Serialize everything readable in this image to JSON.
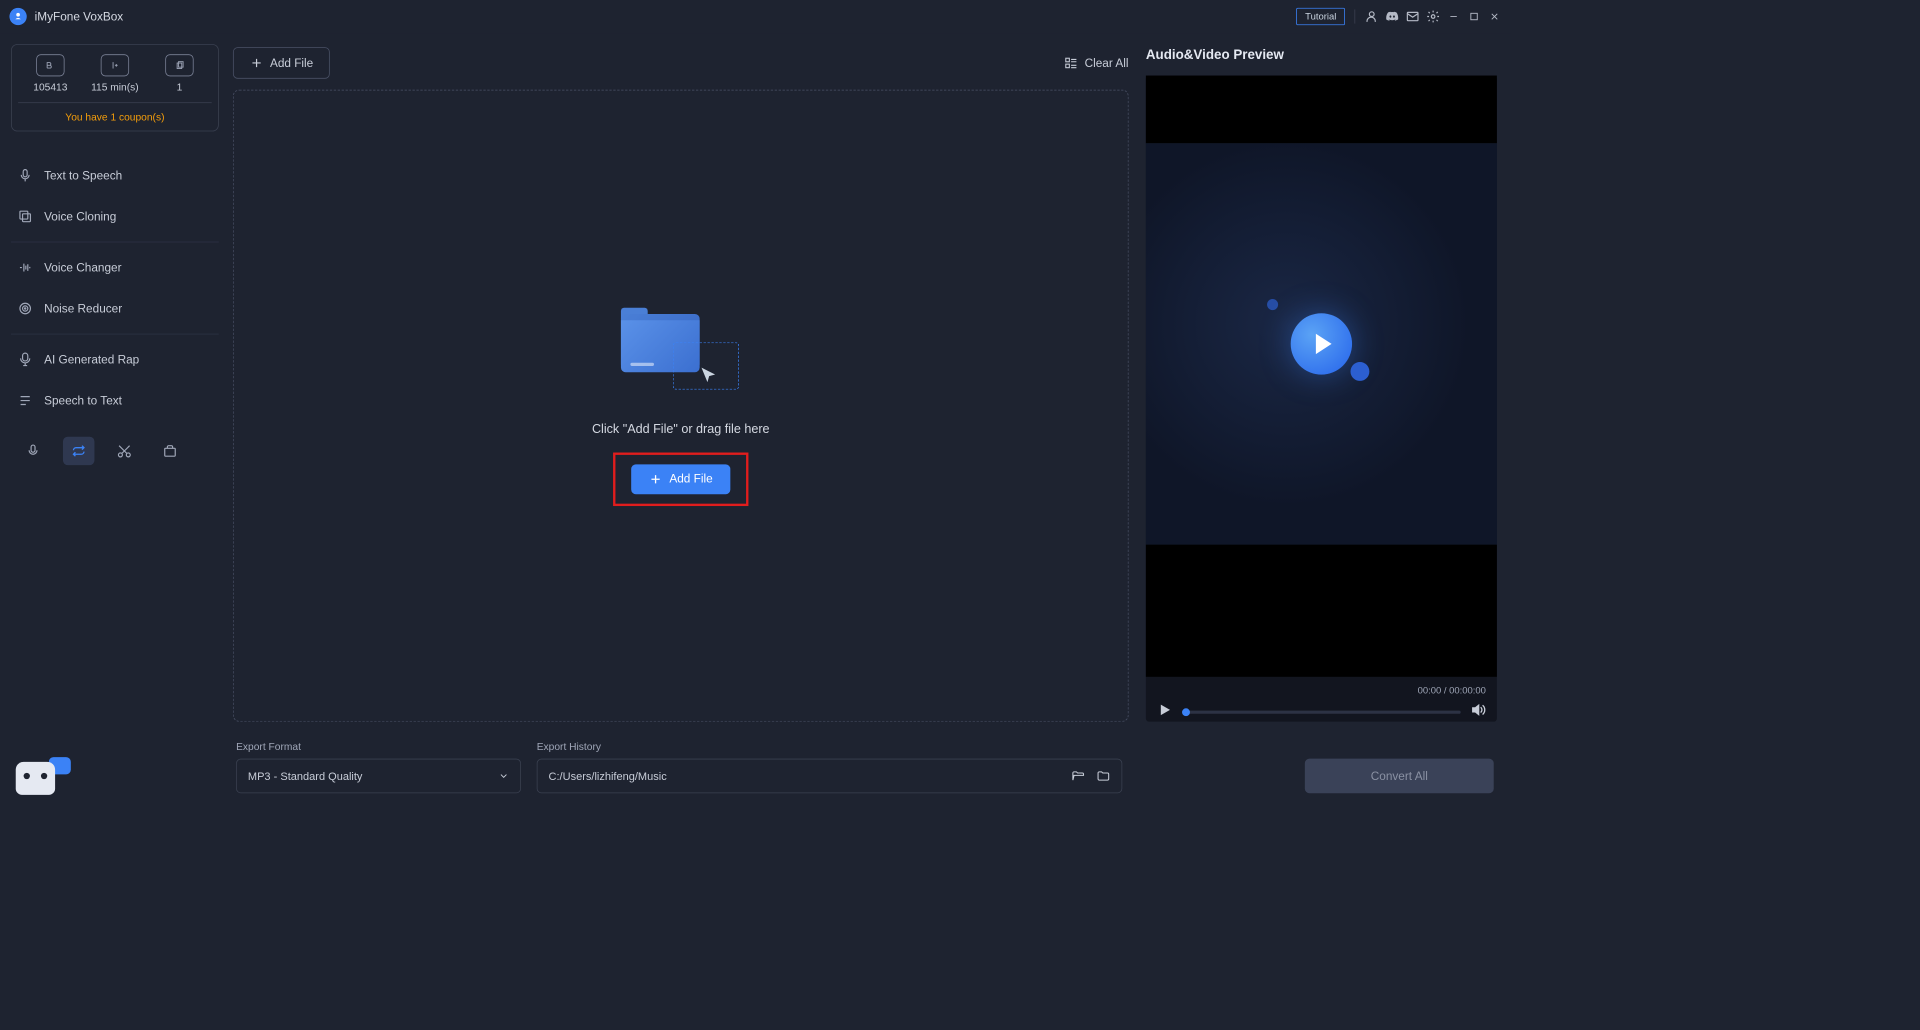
{
  "titlebar": {
    "app_name": "iMyFone VoxBox",
    "tutorial_label": "Tutorial"
  },
  "sidebar": {
    "stats": {
      "characters": "105413",
      "minutes": "115 min(s)",
      "count": "1"
    },
    "coupon_text": "You have 1 coupon(s)",
    "nav": [
      {
        "label": "Text to Speech",
        "icon": "mic-text-icon"
      },
      {
        "label": "Voice Cloning",
        "icon": "clone-icon"
      },
      {
        "label": "Voice Changer",
        "icon": "voice-change-icon"
      },
      {
        "label": "Noise Reducer",
        "icon": "noise-icon"
      },
      {
        "label": "AI Generated Rap",
        "icon": "rap-icon"
      },
      {
        "label": "Speech to Text",
        "icon": "stt-icon"
      }
    ]
  },
  "workspace": {
    "add_file_label": "Add File",
    "clear_all_label": "Clear All",
    "dropzone_text": "Click \"Add File\" or drag file here",
    "add_file_solid_label": "Add File"
  },
  "preview": {
    "title": "Audio&Video Preview",
    "time_current": "00:00",
    "time_sep": " / ",
    "time_total": "00:00:00"
  },
  "bottom": {
    "export_format_label": "Export Format",
    "export_format_value": "MP3 - Standard Quality",
    "export_history_label": "Export History",
    "export_history_path": "C:/Users/lizhifeng/Music",
    "convert_label": "Convert All"
  }
}
